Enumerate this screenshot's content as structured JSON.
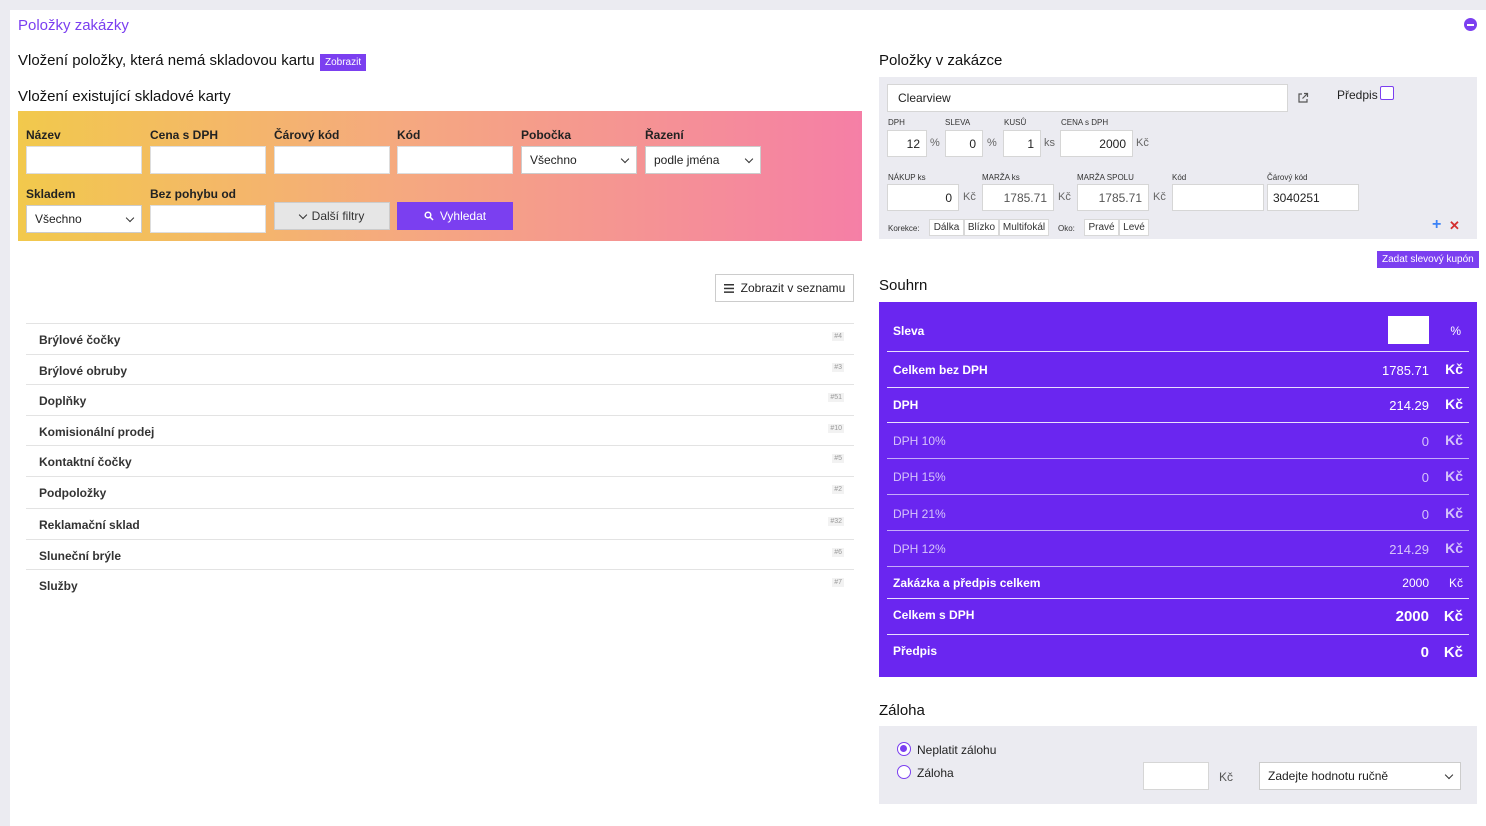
{
  "header": {
    "title": "Položky zakázky"
  },
  "left": {
    "new_item_heading": "Vložení položky, která nemá skladovou kartu",
    "show_button": "Zobrazit",
    "existing_heading": "Vložení existující skladové karty",
    "filters": {
      "name_label": "Název",
      "price_label": "Cena s DPH",
      "barcode_label": "Čárový kód",
      "code_label": "Kód",
      "branch_label": "Pobočka",
      "branch_value": "Všechno",
      "sort_label": "Řazení",
      "sort_value": "podle jména",
      "stock_label": "Skladem",
      "stock_value": "Všechno",
      "nomove_label": "Bez pohybu od",
      "more_filters": "Další filtry",
      "search_button": "Vyhledat"
    },
    "list_view_button": "Zobrazit v seznamu",
    "categories": [
      {
        "label": "Brýlové čočky",
        "count": "#4"
      },
      {
        "label": "Brýlové obruby",
        "count": "#3"
      },
      {
        "label": "Doplňky",
        "count": "#51"
      },
      {
        "label": "Komisionální prodej",
        "count": "#10"
      },
      {
        "label": "Kontaktní čočky",
        "count": "#5"
      },
      {
        "label": "Podpoložky",
        "count": "#2"
      },
      {
        "label": "Reklamační sklad",
        "count": "#32"
      },
      {
        "label": "Sluneční brýle",
        "count": "#6"
      },
      {
        "label": "Služby",
        "count": "#7"
      }
    ]
  },
  "items": {
    "heading": "Položky v zakázce",
    "item_name": "Clearview",
    "predpis_label": "Předpis",
    "dph_label": "DPH",
    "dph_value": "12",
    "dph_unit": "%",
    "sleva_label": "SLEVA",
    "sleva_value": "0",
    "sleva_unit": "%",
    "kusu_label": "KUSŮ",
    "kusu_value": "1",
    "kusu_unit": "ks",
    "cena_label": "CENA s DPH",
    "cena_value": "2000",
    "cena_unit": "Kč",
    "nakup_label": "NÁKUP ks",
    "nakup_value": "0",
    "nakup_unit": "Kč",
    "marza_label": "MARŽA ks",
    "marza_value": "1785.71",
    "marza_unit": "Kč",
    "marza_spolu_label": "MARŽA SPOLU",
    "marza_spolu_value": "1785.71",
    "marza_spolu_unit": "Kč",
    "kod_label": "Kód",
    "kod_value": "",
    "barcode_label": "Čárový kód",
    "barcode_value": "3040251",
    "korekce_label": "Korekce:",
    "korekce_options": [
      "Dálka",
      "Blízko",
      "Multifokál"
    ],
    "oko_label": "Oko:",
    "oko_options": [
      "Pravé",
      "Levé"
    ],
    "plus_symbol": "+",
    "remove_symbol": "✕",
    "coupon_button": "Zadat slevový kupón"
  },
  "summary": {
    "heading": "Souhrn",
    "discount_label": "Sleva",
    "discount_unit": "%",
    "rows": [
      {
        "label": "Celkem bez DPH",
        "value": "1785.71",
        "unit": "Kč"
      },
      {
        "label": "DPH",
        "value": "214.29",
        "unit": "Kč"
      },
      {
        "label": "DPH 10%",
        "value": "0",
        "unit": "Kč"
      },
      {
        "label": "DPH 15%",
        "value": "0",
        "unit": "Kč"
      },
      {
        "label": "DPH 21%",
        "value": "0",
        "unit": "Kč"
      },
      {
        "label": "DPH 12%",
        "value": "214.29",
        "unit": "Kč"
      },
      {
        "label": "Zakázka a předpis celkem",
        "value": "2000",
        "unit": "Kč"
      },
      {
        "label": "Celkem s DPH",
        "value": "2000",
        "unit": "Kč"
      },
      {
        "label": "Předpis",
        "value": "0",
        "unit": "Kč"
      }
    ]
  },
  "deposit": {
    "heading": "Záloha",
    "option_no": "Neplatit zálohu",
    "option_yes": "Záloha",
    "unit": "Kč",
    "select_value": "Zadejte hodnotu ručně"
  },
  "colors": {
    "accent": "#7b3ff0",
    "summary_bg": "#6a26f0"
  }
}
